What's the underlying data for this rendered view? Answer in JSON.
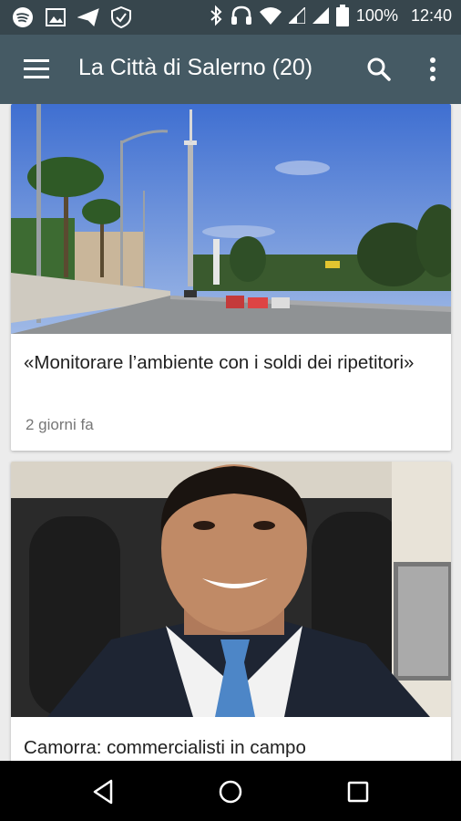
{
  "status_bar": {
    "battery": "100%",
    "time": "12:40",
    "icons": [
      "spotify-icon",
      "image-icon",
      "send-icon",
      "vpn-shield-icon",
      "bluetooth-icon",
      "headphones-icon",
      "wifi-icon",
      "signal-icon",
      "signal-icon-2",
      "battery-icon"
    ]
  },
  "app_bar": {
    "title": "La Città di Salerno (20)",
    "background": "#455a64"
  },
  "articles": [
    {
      "headline": "«Monitorare l’ambiente con i soldi dei ripetitori»",
      "time": "2 giorni fa",
      "image": "street-with-antenna-tower-photo"
    },
    {
      "headline": "Camorra: commercialisti in campo",
      "image": "man-in-suit-portrait-photo"
    }
  ],
  "nav_bar": {
    "buttons": [
      "back",
      "home",
      "recents"
    ]
  }
}
